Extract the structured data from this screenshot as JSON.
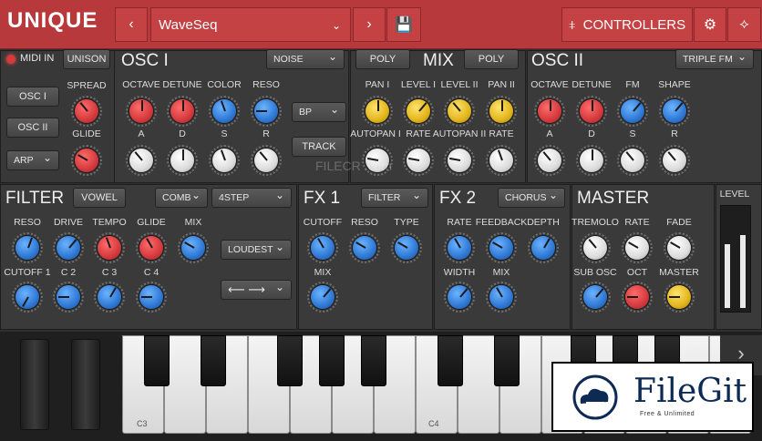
{
  "header": {
    "brand": "UNIQUE",
    "preset": "WaveSeq",
    "controllers": "CONTROLLERS"
  },
  "osc1": {
    "title": "OSC I",
    "midi_in": "MIDI IN",
    "unison": "UNISON",
    "noise": "NOISE",
    "osc1_btn": "OSC I",
    "osc2_btn": "OSC II",
    "arp": "ARP",
    "spread": "SPREAD",
    "glide": "GLIDE",
    "octave": "OCTAVE",
    "detune": "DETUNE",
    "color": "COLOR",
    "reso": "RESO",
    "a": "A",
    "d": "D",
    "s": "S",
    "r": "R",
    "bp": "BP",
    "track": "TRACK"
  },
  "mix": {
    "title": "MIX",
    "poly1": "POLY",
    "poly2": "POLY",
    "pan1": "PAN I",
    "level1": "LEVEL I",
    "level2": "LEVEL II",
    "pan2": "PAN II",
    "autopan1": "AUTOPAN I",
    "rate1": "RATE",
    "autopan2": "AUTOPAN II",
    "rate2": "RATE"
  },
  "osc2": {
    "title": "OSC II",
    "mode": "TRIPLE FM",
    "octave": "OCTAVE",
    "detune": "DETUNE",
    "fm": "FM",
    "shape": "SHAPE",
    "a": "A",
    "d": "D",
    "s": "S",
    "r": "R"
  },
  "filter": {
    "title": "FILTER",
    "vowel": "VOWEL",
    "comb": "COMB",
    "step": "4STEP",
    "reso": "RESO",
    "drive": "DRIVE",
    "tempo": "TEMPO",
    "glide": "GLIDE",
    "mix": "MIX",
    "loudest": "LOUDEST",
    "cutoff1": "CUTOFF 1",
    "c2": "C 2",
    "c3": "C 3",
    "c4": "C 4",
    "arrows": "⟵ ⟶"
  },
  "fx1": {
    "title": "FX 1",
    "filter": "FILTER",
    "cutoff": "CUTOFF",
    "reso": "RESO",
    "type": "TYPE",
    "mix": "MIX"
  },
  "fx2": {
    "title": "FX 2",
    "chorus": "CHORUS",
    "rate": "RATE",
    "feedback": "FEEDBACK",
    "depth": "DEPTH",
    "width": "WIDTH",
    "mix": "MIX"
  },
  "master": {
    "title": "MASTER",
    "level": "LEVEL",
    "tremolo": "TREMOLO",
    "rate": "RATE",
    "fade": "FADE",
    "subosc": "SUB OSC",
    "oct": "OCT",
    "master": "MASTER"
  },
  "keyboard": {
    "c3": "C3",
    "c4": "C4"
  },
  "watermark": {
    "logo": "FileGit",
    "tagline": "Free & Unlimited",
    "site": "FILECR .com"
  }
}
